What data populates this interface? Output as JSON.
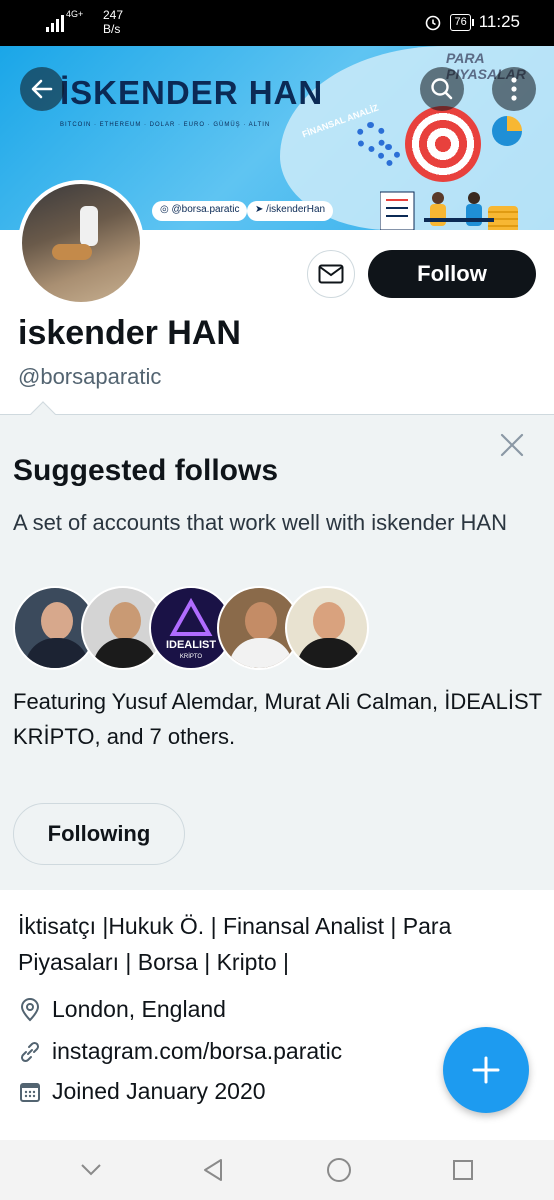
{
  "status_bar": {
    "network": "4G+",
    "speed_value": "247",
    "speed_unit": "B/s",
    "battery": "76",
    "time": "11:25"
  },
  "banner": {
    "title": "İSKENDER HAN",
    "subtitle": "BITCOIN · ETHEREUM · DOLAR · EURO · GÜMÜŞ · ALTIN",
    "corner_text": "PARA PIYASALAR",
    "side_text": "FİNANSAL ANALİZ",
    "instagram": "@borsa.paratic",
    "telegram": "/iskenderHan",
    "accent_color": "#1aa6e8"
  },
  "icons": {
    "back": "back-arrow-icon",
    "search": "search-icon",
    "more": "more-vertical-icon",
    "message": "mail-icon",
    "close": "close-icon",
    "location": "location-icon",
    "link": "link-icon",
    "calendar": "calendar-icon",
    "compose": "plus-icon"
  },
  "profile": {
    "display_name": "iskender HAN",
    "handle": "@borsaparatic",
    "follow_label": "Follow",
    "bio": "İktisatçı |Hukuk Ö. | Finansal Analist | Para Piyasaları | Borsa | Kripto |",
    "location": "London, England",
    "website": "instagram.com/borsa.paratic",
    "joined": "Joined January 2020"
  },
  "suggested": {
    "title": "Suggested follows",
    "description": "A set of accounts that work well with iskender HAN",
    "featuring": "Featuring Yusuf Alemdar, Murat Ali Calman, İDEALİST KRİPTO, and 7 others.",
    "following_label": "Following",
    "logo_text": "IDEALIST",
    "logo_sub": "KRİPTO"
  },
  "colors": {
    "follow_button": "#0f1419",
    "fab": "#1d9bf0",
    "panel_bg": "#eff3f4"
  }
}
